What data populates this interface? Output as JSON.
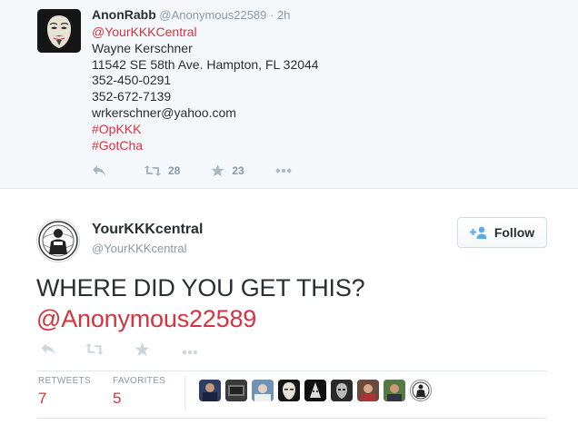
{
  "parent_tweet": {
    "author_name": "AnonRabb",
    "author_handle": "@Anonymous22589",
    "separator": "·",
    "time": "2h",
    "lines": [
      {
        "text": "@YourKKKCentral",
        "kind": "link"
      },
      {
        "text": "Wayne Kerschner",
        "kind": "text"
      },
      {
        "text": "11542 SE 58th Ave. Hampton, FL 32044",
        "kind": "text"
      },
      {
        "text": "352-450-0291",
        "kind": "text"
      },
      {
        "text": "352-672-7139",
        "kind": "text"
      },
      {
        "text": "wrkerschner@yahoo.com",
        "kind": "text"
      },
      {
        "text": "#OpKKK",
        "kind": "link"
      },
      {
        "text": "#GotCha",
        "kind": "link"
      }
    ],
    "actions": {
      "retweet_count": "28",
      "favorite_count": "23"
    }
  },
  "main_tweet": {
    "author_name": "YourKKKcentral",
    "author_handle": "@YourKKKcentral",
    "follow_label": "Follow",
    "text_line1": "WHERE DID YOU GET THIS?",
    "text_line2": "@Anonymous22589",
    "stats": {
      "retweets_label": "RETWEETS",
      "retweets_count": "7",
      "favorites_label": "FAVORITES",
      "favorites_count": "5"
    },
    "favoriter_avatars_count": 9
  },
  "colors": {
    "link": "#d4333f",
    "muted": "#8899a6",
    "text": "#292f33",
    "follow_icon": "#55acee"
  },
  "icons": [
    "reply-icon",
    "retweet-icon",
    "favorite-star-icon",
    "more-dots-icon",
    "follow-person-plus-icon"
  ]
}
